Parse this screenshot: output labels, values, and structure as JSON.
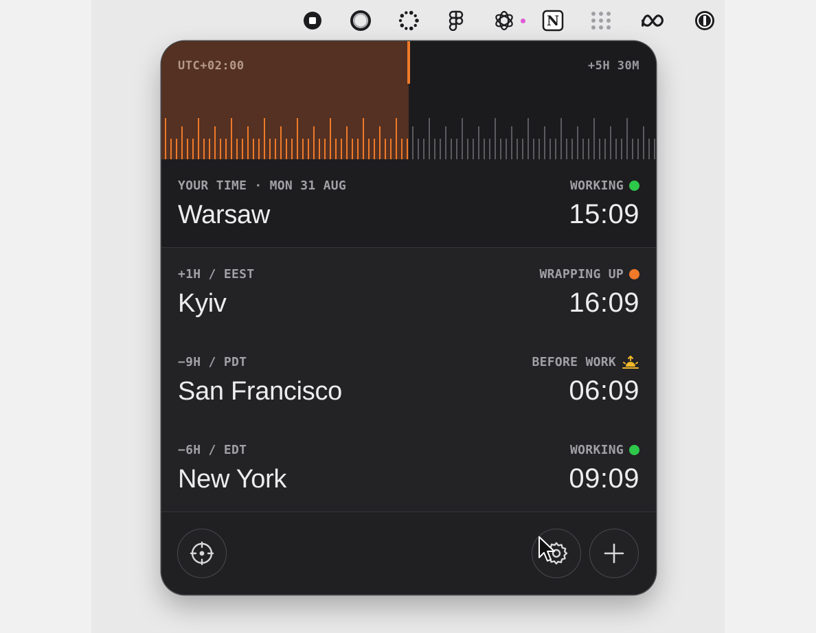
{
  "menubar": {
    "icons": [
      "stop-icon",
      "ring-icon",
      "dotted-circle-icon",
      "figma-icon",
      "openai-icon",
      "notion-icon",
      "grid-icon",
      "meta-icon",
      "onepassword-icon"
    ],
    "notion_letter": "N",
    "notification_dot_color": "#e05ad6"
  },
  "timeline": {
    "left_label": "UTC+02:00",
    "right_label": "+5H 30M",
    "past_color": "#543122",
    "accent_color": "#f07a2a"
  },
  "cities": [
    {
      "meta": "YOUR TIME · MON 31 AUG",
      "name": "Warsaw",
      "status": "WORKING",
      "status_color": "#2ec84a",
      "time": "15:09"
    },
    {
      "meta": "+1H / EEST",
      "name": "Kyiv",
      "status": "WRAPPING UP",
      "status_color": "#f07a2a",
      "time": "16:09"
    },
    {
      "meta": "−9H / PDT",
      "name": "San Francisco",
      "status": "BEFORE WORK",
      "status_icon": "sunrise-icon",
      "status_color": "#f2b82a",
      "time": "06:09"
    },
    {
      "meta": "−6H / EDT",
      "name": "New York",
      "status": "WORKING",
      "status_color": "#2ec84a",
      "time": "09:09"
    }
  ],
  "footer": {
    "buttons": [
      "locate-icon",
      "settings-icon",
      "add-icon"
    ]
  }
}
